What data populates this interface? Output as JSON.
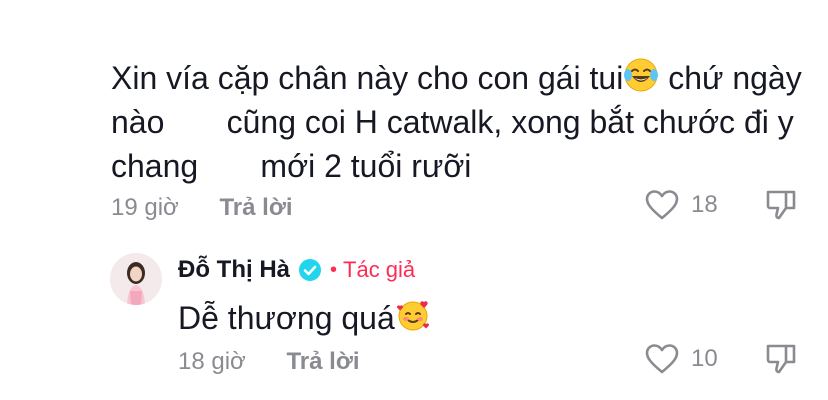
{
  "comment": {
    "lines": [
      "Xin vía cặp chân này cho con gái tui",
      " chứ ngày",
      "nào       cũng coi H catwalk, xong bắt chước đi y",
      "chang       mới 2 tuổi rưỡi"
    ],
    "emoji": "laughing-tears-icon",
    "time": "19 giờ",
    "reply_label": "Trả lời",
    "likes": "18"
  },
  "reply": {
    "author_name": "Đỗ Thị Hà",
    "author_tag_separator": "•",
    "author_tag": "Tác giả",
    "text": "Dễ thương quá",
    "emoji": "smiling-hearts-icon",
    "time": "18 giờ",
    "reply_label": "Trả lời",
    "likes": "10"
  },
  "colors": {
    "accent": "#fe2c55",
    "verified": "#20d5ec",
    "muted": "#8a8b91",
    "text": "#161823"
  }
}
